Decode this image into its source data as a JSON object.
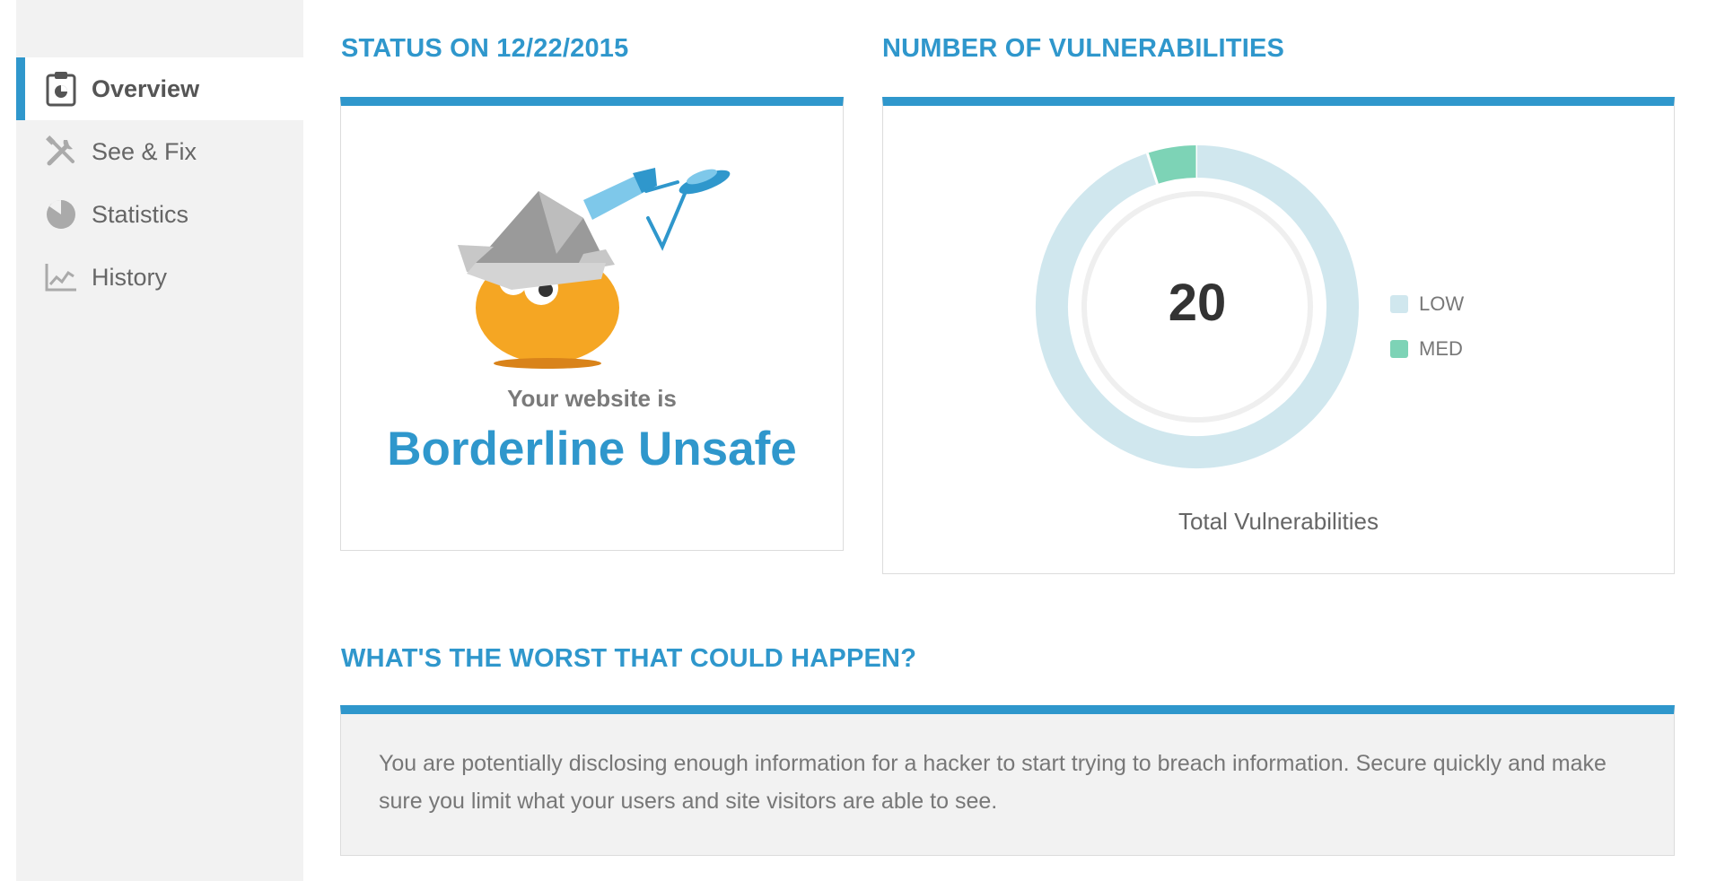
{
  "sidebar": {
    "items": [
      {
        "label": "Overview",
        "icon": "clipboard-icon",
        "active": true
      },
      {
        "label": "See & Fix",
        "icon": "tools-icon",
        "active": false
      },
      {
        "label": "Statistics",
        "icon": "pie-icon",
        "active": false
      },
      {
        "label": "History",
        "icon": "line-chart-icon",
        "active": false
      }
    ]
  },
  "status": {
    "heading": "STATUS ON 12/22/2015",
    "subtitle": "Your website is",
    "rating": "Borderline Unsafe"
  },
  "vulnerabilities": {
    "heading": "NUMBER OF VULNERABILITIES",
    "total": "20",
    "total_label": "Total Vulnerabilities",
    "legend": [
      {
        "label": "LOW",
        "color": "#d0e7ee"
      },
      {
        "label": "MED",
        "color": "#7dd3b6"
      }
    ]
  },
  "chart_data": {
    "type": "pie",
    "categories": [
      "LOW",
      "MED"
    ],
    "values": [
      19,
      1
    ],
    "colors": [
      "#d0e7ee",
      "#7dd3b6"
    ],
    "center_label": "20"
  },
  "worst": {
    "heading": "WHAT'S THE WORST THAT COULD HAPPEN?",
    "text": "You are potentially disclosing enough information for a hacker to start trying to breach information. Secure quickly and make sure you limit what your users and site visitors are able to see."
  },
  "colors": {
    "accent": "#2f97cc",
    "sidebar_bg": "#f2f2f2"
  }
}
